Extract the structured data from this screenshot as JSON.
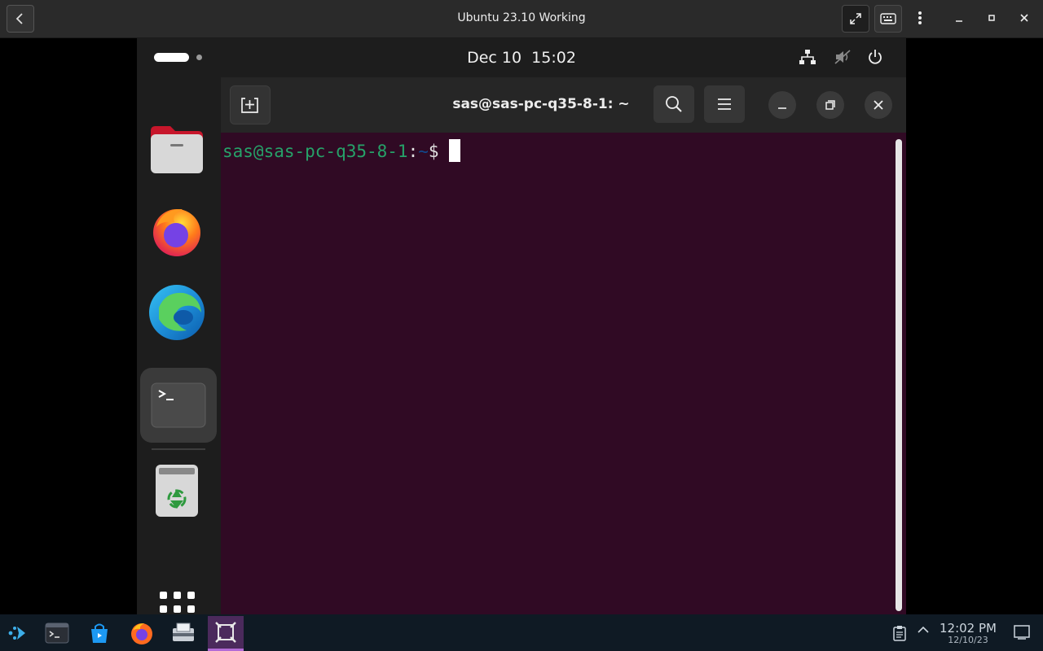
{
  "host": {
    "title": "Ubuntu 23.10 Working",
    "icons": [
      "back-icon",
      "fullscreen-icon",
      "keyboard-icon",
      "kebab-menu-icon",
      "minimize-icon",
      "maximize-icon",
      "close-icon"
    ]
  },
  "guest": {
    "top_bar": {
      "date": "Dec 10",
      "time": "15:02",
      "tray_icons": [
        "network-icon",
        "volume-muted-icon",
        "power-icon"
      ]
    },
    "dock": {
      "items": [
        "Files",
        "Firefox",
        "Microsoft Edge",
        "Terminal",
        "Trash",
        "Show Apps"
      ],
      "running_indicator_color": "#e95420"
    },
    "terminal": {
      "title": "sas@sas-pc-q35-8-1: ~",
      "prompt_user": "sas@sas-pc-q35-8-1",
      "prompt_colon": ":",
      "prompt_path": "~",
      "prompt_symbol": "$",
      "background": "#300a24",
      "user_color": "#26a269",
      "path_color": "#12488b"
    }
  },
  "taskbar": {
    "apps": [
      "launcher-icon",
      "terminal-icon",
      "store-icon",
      "firefox-icon",
      "file-manager-icon",
      "virtual-machine-icon"
    ],
    "time": "12:02 PM",
    "date": "12/10/23",
    "active_color": "#4b2a5c"
  }
}
